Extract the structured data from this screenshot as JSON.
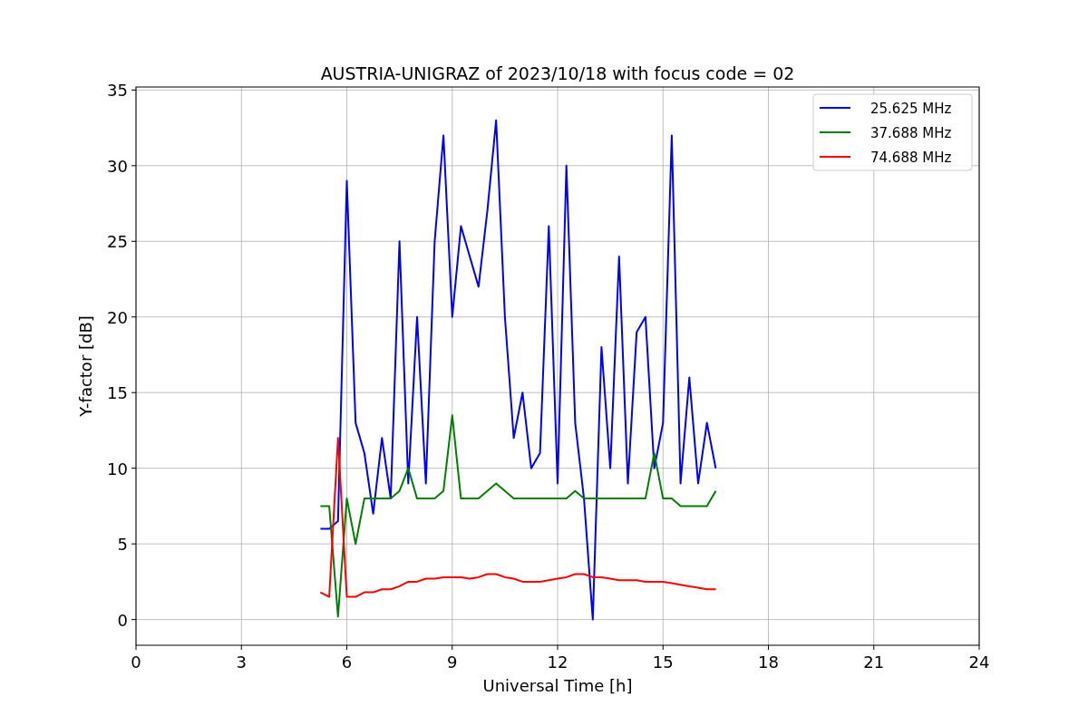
{
  "chart_data": {
    "type": "line",
    "title": "AUSTRIA-UNIGRAZ of 2023/10/18 with focus code = 02",
    "xlabel": "Universal Time [h]",
    "ylabel": "Y-factor [dB]",
    "x": [
      5.25,
      5.5,
      5.75,
      6.0,
      6.25,
      6.5,
      6.75,
      7.0,
      7.25,
      7.5,
      7.75,
      8.0,
      8.25,
      8.5,
      8.75,
      9.0,
      9.25,
      9.5,
      9.75,
      10.0,
      10.25,
      10.5,
      10.75,
      11.0,
      11.25,
      11.5,
      11.75,
      12.0,
      12.25,
      12.5,
      12.75,
      13.0,
      13.25,
      13.5,
      13.75,
      14.0,
      14.25,
      14.5,
      14.75,
      15.0,
      15.25,
      15.5,
      15.75,
      16.0,
      16.25,
      16.5
    ],
    "xlim": [
      0,
      24
    ],
    "ylim": [
      -1.7,
      35.2
    ],
    "grid": true,
    "legend": true,
    "xticks": [
      0,
      3,
      6,
      9,
      12,
      15,
      18,
      21,
      24
    ],
    "yticks": [
      0,
      5,
      10,
      15,
      20,
      25,
      30,
      35
    ],
    "series": [
      {
        "name": "25.625 MHz",
        "color": "#0000ff",
        "values": [
          6,
          6,
          6.5,
          29,
          13,
          11,
          7,
          12,
          8,
          25,
          9,
          20,
          9,
          25,
          32,
          20,
          26,
          24,
          22,
          27,
          33,
          20,
          12,
          15,
          10,
          11,
          26,
          9,
          30,
          13,
          8,
          0,
          18,
          10,
          24,
          9,
          19,
          20,
          10,
          13,
          32,
          9,
          16,
          9,
          13,
          10
        ]
      },
      {
        "name": "37.688 MHz",
        "color": "#008000",
        "values": [
          7.5,
          7.5,
          0.2,
          8,
          5,
          8,
          8,
          8,
          8,
          8.5,
          10,
          8,
          8,
          8,
          8.5,
          13.5,
          8,
          8,
          8,
          8.5,
          9,
          8.5,
          8,
          8,
          8,
          8,
          8,
          8,
          8,
          8.5,
          8,
          8,
          8,
          8,
          8,
          8,
          8,
          8,
          11,
          8,
          8,
          7.5,
          7.5,
          7.5,
          7.5,
          8.5
        ]
      },
      {
        "name": "74.688 MHz",
        "color": "#ff0000",
        "values": [
          1.8,
          1.5,
          12,
          1.5,
          1.5,
          1.8,
          1.8,
          2,
          2,
          2.2,
          2.5,
          2.5,
          2.7,
          2.7,
          2.8,
          2.8,
          2.8,
          2.7,
          2.8,
          3,
          3,
          2.8,
          2.7,
          2.5,
          2.5,
          2.5,
          2.6,
          2.7,
          2.8,
          3,
          3,
          2.8,
          2.8,
          2.7,
          2.6,
          2.6,
          2.6,
          2.5,
          2.5,
          2.5,
          2.4,
          2.3,
          2.2,
          2.1,
          2,
          2
        ]
      }
    ]
  }
}
